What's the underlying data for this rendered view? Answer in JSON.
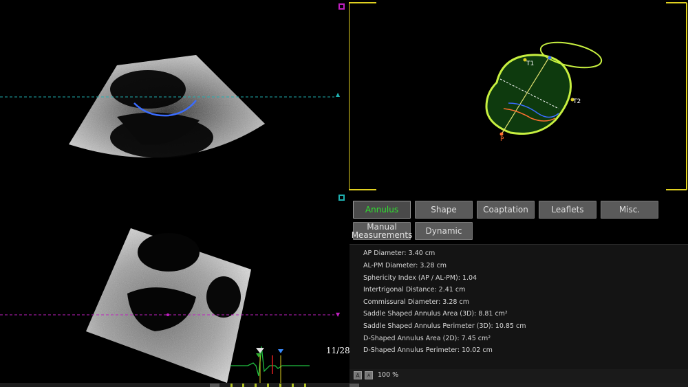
{
  "tabs": {
    "annulus": "Annulus",
    "shape": "Shape",
    "coaptation": "Coaptation",
    "leaflets": "Leaflets",
    "misc": "Misc.",
    "manual_measurements": "Manual Measurements",
    "dynamic": "Dynamic"
  },
  "measurements": [
    "AP Diameter: 3.40 cm",
    "AL-PM Diameter: 3.28 cm",
    "Sphericity Index (AP / AL-PM): 1.04",
    "Intertrigonal Distance: 2.41 cm",
    "Commissural Diameter: 3.28 cm",
    "Saddle Shaped Annulus Area (3D): 8.81 cm²",
    "Saddle Shaped Annulus Perimeter (3D): 10.85 cm",
    "D-Shaped Annulus Area (2D): 7.45 cm²",
    "D-Shaped Annulus Perimeter: 10.02 cm"
  ],
  "frame_counter": "11/28",
  "zoom": {
    "decrease_label": "A",
    "increase_label": "A",
    "value": "100 %"
  },
  "model_labels": {
    "t1": "T1",
    "t2": "T2",
    "p": "P"
  },
  "colors": {
    "active_tab_text": "#2fe02f",
    "annulus_ring": "#c8f040",
    "annulus_trace_blue": "#3a6cff",
    "cyan_plane": "#1fb0b0",
    "magenta_plane": "#c020c0",
    "frame_marker_yellow": "#e0d020",
    "ecg_trace": "#20c040"
  }
}
